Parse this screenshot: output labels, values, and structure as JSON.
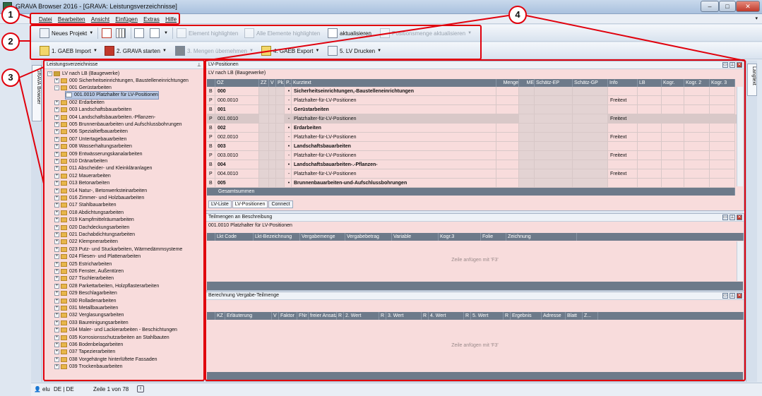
{
  "window": {
    "title": "GRAVA Browser 2016 - [GRAVA: Leistungsverzeichnisse]",
    "min": "–",
    "max": "□",
    "close": "✕"
  },
  "menu": [
    "Datei",
    "Bearbeiten",
    "Ansicht",
    "Einfügen",
    "Extras",
    "Hilfe"
  ],
  "toolbar1": {
    "new_project": "Neues Projekt",
    "element_highlight": "Element highlighten",
    "all_elements_highlight": "Alle Elemente highlighten",
    "refresh": "aktualisieren",
    "quantities_refresh": "Positionsmenge aktualisieren"
  },
  "toolbar2": {
    "gaeb_import": "1. GAEB Import",
    "grava_start": "2. GRAVA starten",
    "take_quantities": "3. Mengen übernehmen",
    "gaeb_export": "4. GAEB Export",
    "lv_print": "5. LV Drucken",
    "gaeb_badge": "GAEB",
    "cad_badge": "CAD"
  },
  "sidebar_left_tab": "GRAVA Browser",
  "sidebar_right_tab": "Langtext",
  "tree": {
    "title": "Leistungsverzeichnisse",
    "root": "LV nach LB (Baugewerke)",
    "items": [
      {
        "label": "000  Sicherheitseinrichtungen, Baustelleneinrichtungen",
        "level": 1,
        "sign": "+"
      },
      {
        "label": "001  Gerüstarbeiten",
        "level": 1,
        "sign": "-"
      },
      {
        "label": "001.0010  Platzhalter für LV-Positionen",
        "level": 2,
        "sign": "",
        "selected": true
      },
      {
        "label": "002  Erdarbeiten",
        "level": 1,
        "sign": "+"
      },
      {
        "label": "003  Landschaftsbauarbeiten",
        "level": 1,
        "sign": "+"
      },
      {
        "label": "004  Landschaftsbauarbeiten.-Pflanzen-",
        "level": 1,
        "sign": "+"
      },
      {
        "label": "005  Brunnenbauarbeiten und Aufschlussbohrungen",
        "level": 1,
        "sign": "+"
      },
      {
        "label": "006  Spezialtiefbauarbeiten",
        "level": 1,
        "sign": "+"
      },
      {
        "label": "007  Untertagebauarbeiten",
        "level": 1,
        "sign": "+"
      },
      {
        "label": "008  Wasserhaltungsarbeiten",
        "level": 1,
        "sign": "+"
      },
      {
        "label": "009  Entwässerungskanalarbeiten",
        "level": 1,
        "sign": "+"
      },
      {
        "label": "010  Dränarbeiten",
        "level": 1,
        "sign": "+"
      },
      {
        "label": "011  Abscheider- und Kleinkläranlagen",
        "level": 1,
        "sign": "+"
      },
      {
        "label": "012  Mauerarbeiten",
        "level": 1,
        "sign": "+"
      },
      {
        "label": "013  Betonarbeiten",
        "level": 1,
        "sign": "+"
      },
      {
        "label": "014  Natur-, Betonwerksteinarbeiten",
        "level": 1,
        "sign": "+"
      },
      {
        "label": "016  Zimmer- und Holzbauarbeiten",
        "level": 1,
        "sign": "+"
      },
      {
        "label": "017  Stahlbauarbeiten",
        "level": 1,
        "sign": "+"
      },
      {
        "label": "018  Abdichtungsarbeiten",
        "level": 1,
        "sign": "+"
      },
      {
        "label": "019  Kampfmittelräumarbeiten",
        "level": 1,
        "sign": "+"
      },
      {
        "label": "020  Dachdeckungsarbeiten",
        "level": 1,
        "sign": "+"
      },
      {
        "label": "021  Dachabdichtungsarbeiten",
        "level": 1,
        "sign": "+"
      },
      {
        "label": "022  Klempnerarbeiten",
        "level": 1,
        "sign": "+"
      },
      {
        "label": "023  Putz- und Stuckarbeiten, Wärmedämmsysteme",
        "level": 1,
        "sign": "+"
      },
      {
        "label": "024  Fliesen- und Plattenarbeiten",
        "level": 1,
        "sign": "+"
      },
      {
        "label": "025  Estricharbeiten",
        "level": 1,
        "sign": "+"
      },
      {
        "label": "026  Fenster, Außentüren",
        "level": 1,
        "sign": "+"
      },
      {
        "label": "027  Tischlerarbeiten",
        "level": 1,
        "sign": "+"
      },
      {
        "label": "028  Parkettarbeiten, Holzpflasterarbeiten",
        "level": 1,
        "sign": "+"
      },
      {
        "label": "029  Beschlagarbeiten",
        "level": 1,
        "sign": "+"
      },
      {
        "label": "030  Rolladenarbeiten",
        "level": 1,
        "sign": "+"
      },
      {
        "label": "031  Metallbauarbeiten",
        "level": 1,
        "sign": "+"
      },
      {
        "label": "032  Verglasungsarbeiten",
        "level": 1,
        "sign": "+"
      },
      {
        "label": "033  Baureinigungsarbeiten",
        "level": 1,
        "sign": "+"
      },
      {
        "label": "034  Maler- und Lackierarbeiten - Beschichtungen",
        "level": 1,
        "sign": "+"
      },
      {
        "label": "035  Korrosionsschutzarbeiten an Stahlbauten",
        "level": 1,
        "sign": "+"
      },
      {
        "label": "036  Bodenbelagarbeiten",
        "level": 1,
        "sign": "+"
      },
      {
        "label": "037  Tapezierarbeiten",
        "level": 1,
        "sign": "+"
      },
      {
        "label": "038  Vorgehängte hinterlüftete Fassaden",
        "level": 1,
        "sign": "+"
      },
      {
        "label": "039  Trockenbauarbeiten",
        "level": 1,
        "sign": "+"
      }
    ]
  },
  "lvpos": {
    "title": "LV-Positionen",
    "subtitle": "LV nach LB (Baugewerke)",
    "columns": [
      "OZ",
      "ZZ",
      "V",
      "Pk.",
      "P..",
      "Kurztext",
      "Menge",
      "ME",
      "Schätz-EP",
      "Schätz-GP",
      "Info",
      "LB",
      "Kogr.",
      "Kogr. 2",
      "Kogr. 3"
    ],
    "rows": [
      {
        "t": "B",
        "oz": "000",
        "dot": "•",
        "kurz": "Sicherheitseinrichtungen,-Baustelleneinrichtungen",
        "info": "",
        "bold": true
      },
      {
        "t": "P",
        "oz": "000.0010",
        "dot": "-",
        "kurz": "Platzhalter-für-LV-Positionen",
        "info": "Freitext",
        "bold": false
      },
      {
        "t": "B",
        "oz": "001",
        "dot": "•",
        "kurz": "Gerüstarbeiten",
        "info": "",
        "bold": true
      },
      {
        "t": "P",
        "oz": "001.0010",
        "dot": "-",
        "kurz": "Platzhalter-für-LV-Positionen",
        "info": "Freitext",
        "bold": false,
        "selected": true
      },
      {
        "t": "B",
        "oz": "002",
        "dot": "•",
        "kurz": "Erdarbeiten",
        "info": "",
        "bold": true
      },
      {
        "t": "P",
        "oz": "002.0010",
        "dot": "-",
        "kurz": "Platzhalter-für-LV-Positionen",
        "info": "Freitext",
        "bold": false
      },
      {
        "t": "B",
        "oz": "003",
        "dot": "•",
        "kurz": "Landschaftsbauarbeiten",
        "info": "",
        "bold": true
      },
      {
        "t": "P",
        "oz": "003.0010",
        "dot": "-",
        "kurz": "Platzhalter-für-LV-Positionen",
        "info": "Freitext",
        "bold": false
      },
      {
        "t": "B",
        "oz": "004",
        "dot": "•",
        "kurz": "Landschaftsbauarbeiten-.-Pflanzen-",
        "info": "",
        "bold": true
      },
      {
        "t": "P",
        "oz": "004.0010",
        "dot": "-",
        "kurz": "Platzhalter-für-LV-Positionen",
        "info": "Freitext",
        "bold": false
      },
      {
        "t": "B",
        "oz": "005",
        "dot": "•",
        "kurz": "Brunnenbauarbeiten-und-Aufschlussbohrungen",
        "info": "",
        "bold": true
      }
    ],
    "total": "Gesamtsummen",
    "tabs": [
      "LV-Liste",
      "LV-Positionen",
      "Connect"
    ]
  },
  "teilmengen": {
    "title": "Teilmengen an Beschreibung",
    "subtitle": "001.0010 Platzhalter für LV-Positionen",
    "columns": [
      "Lkt Code",
      "Lkt-Bezeichnung",
      "Vergabemenge",
      "Vergabebetrag",
      "Variable",
      "Kogr.3",
      "Folie",
      "Zeichnung"
    ],
    "placeholder": "Zeile anfügen mit 'F3'"
  },
  "berechnung": {
    "title": "Berechnung Vergabe-Teilmenge",
    "columns": [
      "KZ",
      "Erläuterung",
      "V",
      "Faktor",
      "FNr",
      "freier Ansatz",
      "R",
      "2. Wert",
      "R",
      "3. Wert",
      "R",
      "4. Wert",
      "R",
      "5. Wert",
      "R",
      "Ergebnis",
      "Adresse",
      "Blatt",
      "Z..."
    ],
    "placeholder": "Zeile anfügen mit 'F3'"
  },
  "status": {
    "user": "elu",
    "lang": "DE | DE",
    "row": "Zeile 1 von 78"
  },
  "annotations": [
    "1",
    "2",
    "3",
    "4"
  ],
  "colors": {
    "annotation": "#e0000c",
    "panel_bg": "#f8dcdc",
    "grid_header": "#6d7a8a"
  }
}
